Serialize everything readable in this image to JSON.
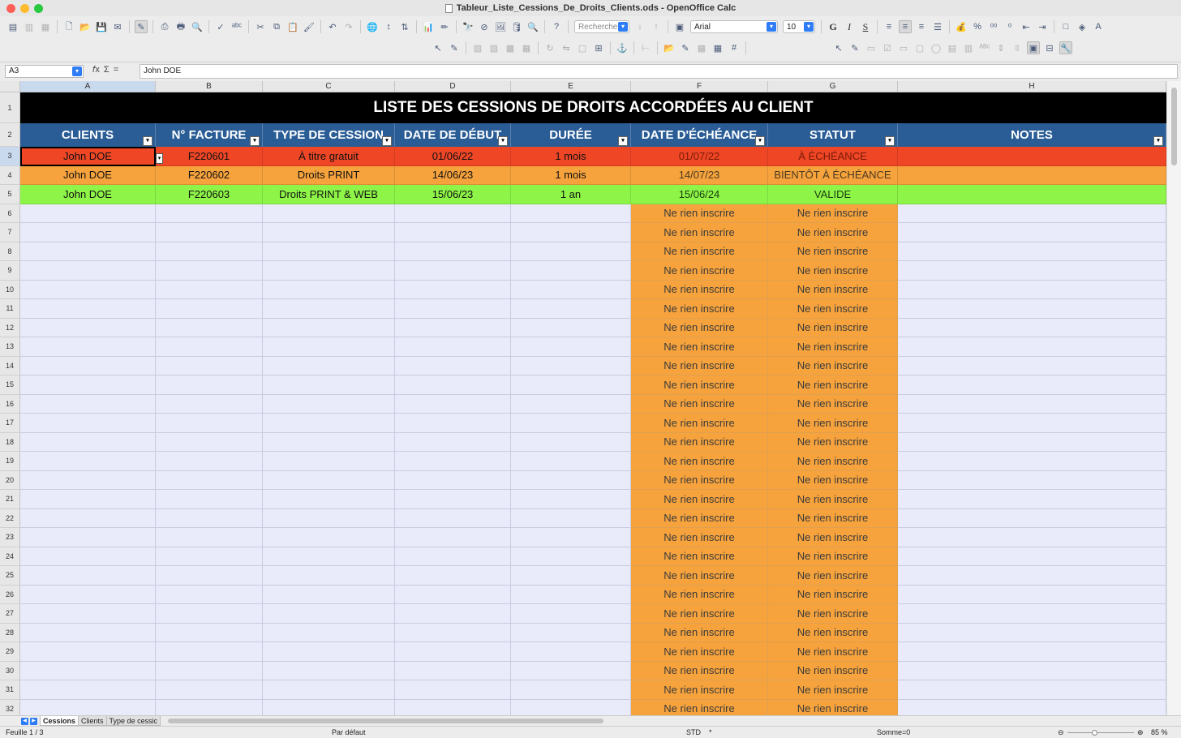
{
  "window": {
    "title": "Tableur_Liste_Cessions_De_Droits_Clients.ods - OpenOffice Calc"
  },
  "toolbar": {
    "find_combo_value": "Rechercher",
    "font_name": "Arial",
    "font_size": "10",
    "bold_label": "G",
    "italic_label": "I",
    "underline_label": "S"
  },
  "formula_bar": {
    "cell_ref": "A3",
    "content": "John DOE"
  },
  "columns": [
    "A",
    "B",
    "C",
    "D",
    "E",
    "F",
    "G",
    "H"
  ],
  "sheet": {
    "title": "LISTE DES CESSIONS DE DROITS ACCORDÉES AU CLIENT",
    "headers": [
      "CLIENTS",
      "N° FACTURE",
      "TYPE DE CESSION",
      "DATE DE DÉBUT",
      "DURÉE",
      "DATE D'ÉCHÉANCE",
      "STATUT",
      "NOTES"
    ],
    "rows": [
      {
        "client": "John DOE",
        "facture": "F220601",
        "type": "À titre gratuit",
        "debut": "01/06/22",
        "duree": "1 mois",
        "echeance": "01/07/22",
        "statut": "À ÉCHÉANCE",
        "notes": "",
        "status_color": "#ef4726"
      },
      {
        "client": "John DOE",
        "facture": "F220602",
        "type": "Droits PRINT",
        "debut": "14/06/23",
        "duree": "1 mois",
        "echeance": "14/07/23",
        "statut": "BIENTÔT À ÉCHÉANCE",
        "notes": "",
        "status_color": "#f6a33d"
      },
      {
        "client": "John DOE",
        "facture": "F220603",
        "type": "Droits PRINT & WEB",
        "debut": "15/06/23",
        "duree": "1 an",
        "echeance": "15/06/24",
        "statut": "VALIDE",
        "notes": "",
        "status_color": "#8ef548"
      }
    ],
    "placeholder_text": "Ne rien inscrire",
    "empty_row_color": "#e9eafa",
    "placeholder_color": "#f6a33d"
  },
  "row_numbers": [
    "1",
    "2",
    "3",
    "4",
    "5",
    "6",
    "7",
    "8",
    "9",
    "10",
    "11",
    "12",
    "13",
    "14",
    "15",
    "16",
    "17",
    "18",
    "19",
    "20",
    "21",
    "22",
    "23",
    "24",
    "25",
    "26",
    "27",
    "28",
    "29",
    "30",
    "31",
    "32"
  ],
  "sheet_tabs": [
    "Cessions",
    "Clients",
    "Type de cessic"
  ],
  "status_bar": {
    "sheet_info": "Feuille 1 / 3",
    "page_style": "Par défaut",
    "mode": "STD",
    "modified": "*",
    "sum": "Somme=0",
    "zoom": "85 %"
  }
}
